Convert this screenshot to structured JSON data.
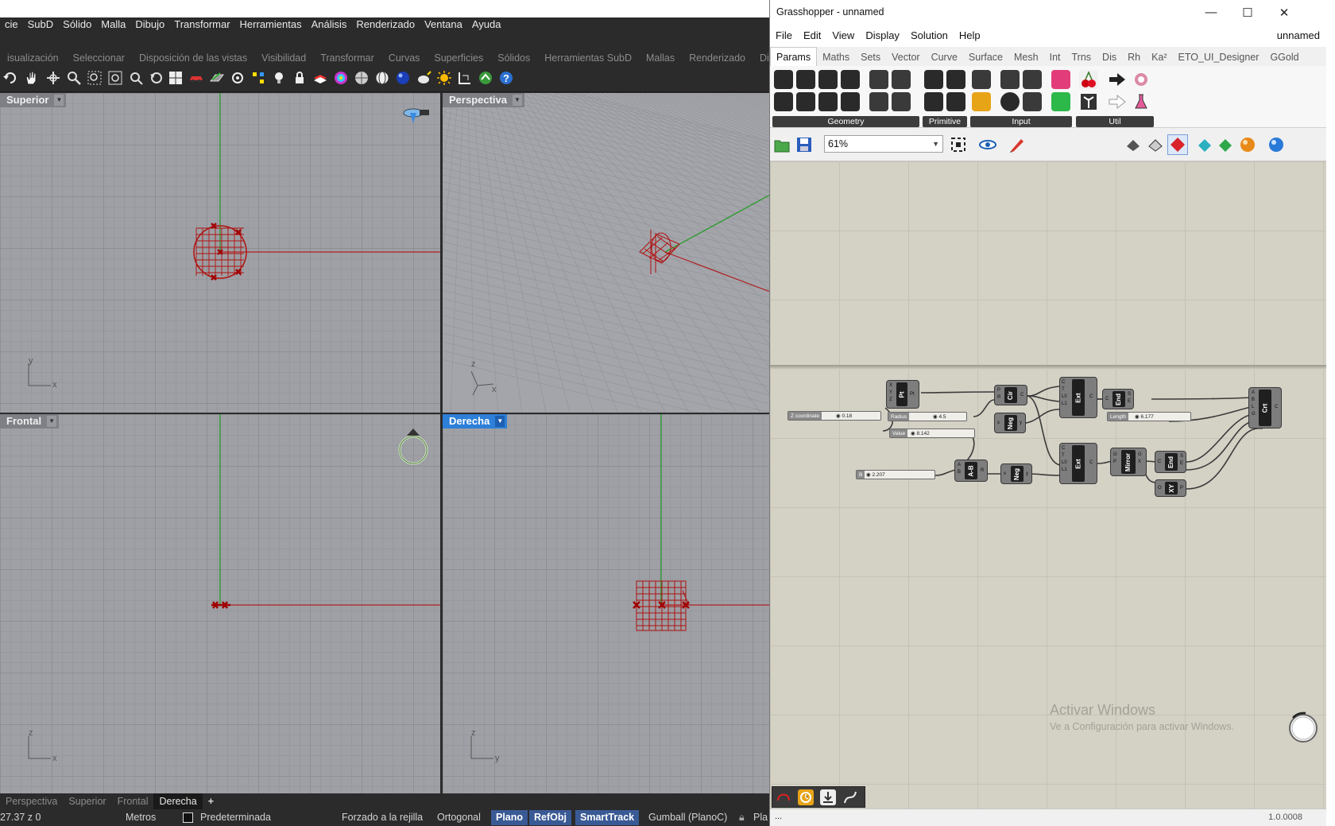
{
  "rhino": {
    "menu": [
      "cie",
      "SubD",
      "Sólido",
      "Malla",
      "Dibujo",
      "Transformar",
      "Herramientas",
      "Análisis",
      "Renderizado",
      "Ventana",
      "Ayuda"
    ],
    "tabs": [
      "isualización",
      "Seleccionar",
      "Disposición de las vistas",
      "Visibilidad",
      "Transformar",
      "Curvas",
      "Superficies",
      "Sólidos",
      "Herramientas SubD",
      "Mallas",
      "Renderizado",
      "Dibujo"
    ],
    "viewports": {
      "top_left": "Superior",
      "top_right": "Perspectiva",
      "bottom_left": "Frontal",
      "bottom_right": "Derecha"
    },
    "axes": {
      "y": "y",
      "x": "x",
      "z": "z"
    },
    "bottom_tabs": [
      "Perspectiva",
      "Superior",
      "Frontal",
      "Derecha"
    ],
    "add_tab": "+",
    "status": {
      "coords": "27.37  z 0",
      "units": "Metros",
      "layer": "Predeterminada",
      "grid_snap": "Forzado a la rejilla",
      "ortho": "Orthogonal",
      "ortho_text": "Ortogonal",
      "planar": "Plano",
      "osnap": "RefObj",
      "smarttrack": "SmartTrack",
      "gumball": "Gumball (PlanoC)",
      "overflow": "Pla"
    },
    "colors": {
      "active_viewport": "#2d7fd8",
      "status_pill": "#3a5a95",
      "geometry": "#b01010",
      "x_axis": "#b02020",
      "y_axis": "#1e9a1e"
    }
  },
  "gh": {
    "title": "Grasshopper - unnamed",
    "window_controls": {
      "minimize": "—",
      "maximize": "☐",
      "close": "✕"
    },
    "menu": [
      "File",
      "Edit",
      "View",
      "Display",
      "Solution",
      "Help"
    ],
    "doc_name": "unnamed",
    "tabs": [
      "Params",
      "Maths",
      "Sets",
      "Vector",
      "Curve",
      "Surface",
      "Mesh",
      "Int",
      "Trns",
      "Dis",
      "Rh",
      "Ka²",
      "ETO_UI_Designer",
      "GGold"
    ],
    "ribbon_groups": [
      "Geometry",
      "Primitive",
      "Input",
      "Util"
    ],
    "zoom": "61%",
    "canvas": {
      "sliders": [
        {
          "label": "Z coordinate",
          "value": "0.18"
        },
        {
          "label": "Radius",
          "value": "4.5"
        },
        {
          "label": "Value",
          "value": "8.142"
        },
        {
          "label": "B",
          "value": "2.207"
        },
        {
          "label": "Length",
          "value": "6.177"
        }
      ],
      "components": [
        {
          "name": "Pt",
          "inputs": "X\nY\nZ",
          "outputs": "Pt"
        },
        {
          "name": "Cir",
          "inputs": "P\nR",
          "outputs": "C"
        },
        {
          "name": "Neg",
          "inputs": "x",
          "outputs": "y"
        },
        {
          "name": "Ext",
          "inputs": "C\nT\nL0\nL1",
          "outputs": "C"
        },
        {
          "name": "End",
          "inputs": "C",
          "outputs": "S\nE"
        },
        {
          "name": "A-B",
          "inputs": "A\nB",
          "outputs": "R"
        },
        {
          "name": "Neg",
          "inputs": "x",
          "outputs": "y"
        },
        {
          "name": "Ext",
          "inputs": "C\nT\nL0\nL1",
          "outputs": "C"
        },
        {
          "name": "Mirror",
          "inputs": "G\nP",
          "outputs": "G\nX"
        },
        {
          "name": "End",
          "inputs": "C",
          "outputs": "S\nE"
        },
        {
          "name": "XY",
          "inputs": "O",
          "outputs": "P"
        },
        {
          "name": "Crt",
          "inputs": "A\nB\nL\nG",
          "outputs": "C"
        }
      ]
    },
    "watermark": {
      "title": "Activar Windows",
      "subtitle": "Ve a Configuración para activar Windows."
    },
    "status_left": "...",
    "version": "1.0.0008"
  }
}
